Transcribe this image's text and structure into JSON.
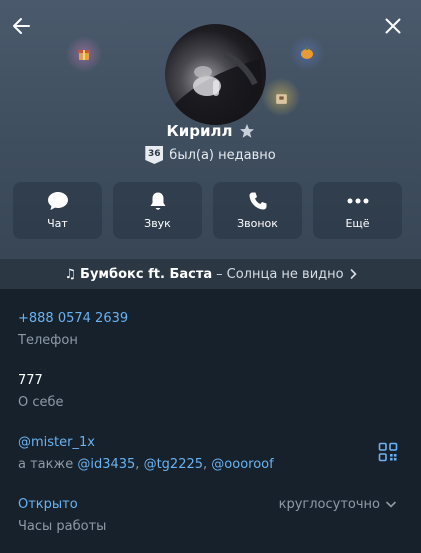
{
  "profile": {
    "name": "Кирилл",
    "level": "36",
    "status": "был(а) недавно"
  },
  "actions": [
    {
      "label": "Чат",
      "icon": "chat-bubble-icon"
    },
    {
      "label": "Звук",
      "icon": "bell-icon"
    },
    {
      "label": "Звонок",
      "icon": "phone-icon"
    },
    {
      "label": "Ещё",
      "icon": "more-dots-icon"
    }
  ],
  "music": {
    "note": "♫",
    "artist": "Бумбокс ft. Баста",
    "separator": "–",
    "title": "Солнца не видно"
  },
  "info": {
    "phone": {
      "value": "+888 0574 2639",
      "label": "Телефон"
    },
    "bio": {
      "value": "777",
      "label": "О себе"
    },
    "username": {
      "value": "@mister_1x",
      "also_prefix": "а также",
      "others": [
        "@id3435",
        "@tg2225",
        "@oooroof"
      ]
    },
    "hours": {
      "value": "Открыто",
      "label": "Часы работы",
      "right": "круглосуточно"
    }
  },
  "colors": {
    "background": "#17212b",
    "header": "#3f4e5e",
    "link": "#6ab2f2",
    "muted": "#8d9aa8"
  }
}
